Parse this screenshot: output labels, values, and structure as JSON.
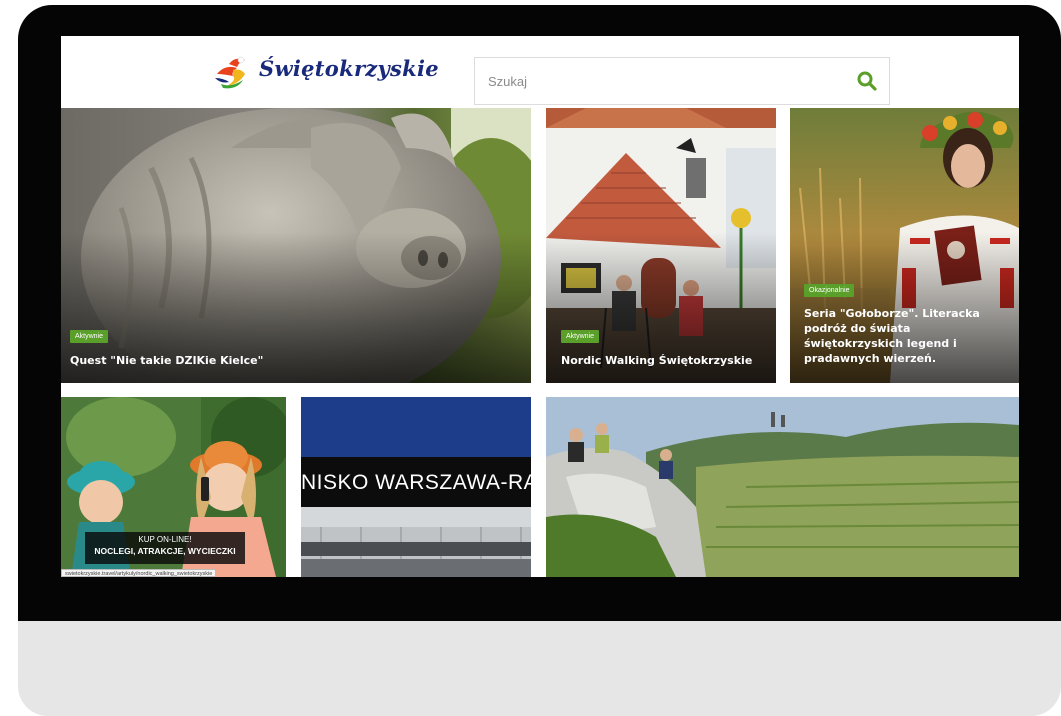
{
  "site": {
    "logo_text": "Świętokrzyskie"
  },
  "search": {
    "placeholder": "Szukaj",
    "icon": "search-icon"
  },
  "tiles": [
    {
      "category": "Aktywnie",
      "title": "Quest \"Nie takie DZIKie Kielce\""
    },
    {
      "category": "Aktywnie",
      "title": "Nordic Walking Świętokrzyskie"
    },
    {
      "category": "Okazjonalnie",
      "title_lines": [
        "Seria \"Gołoborze\". Literacka",
        "podróż do świata",
        "świętokrzyskich legend i",
        "pradawnych wierzeń."
      ]
    }
  ],
  "promo": {
    "line1": "KUP ON-LINE!",
    "line2": "NOCLEGI, ATRAKCJE, WYCIECZKI"
  },
  "airport_sign": "NISKO WARSZAWA-RA",
  "status_url": "swietokrzyskie.travel/artykuly/nordic_walking_swietokrzyskie",
  "colors": {
    "badge_green": "#5a9f2a",
    "search_icon_green": "#5a9f2a",
    "logo_blue": "#1a2a7a",
    "bezel": "#050505",
    "stand": "#e6e6e6"
  }
}
